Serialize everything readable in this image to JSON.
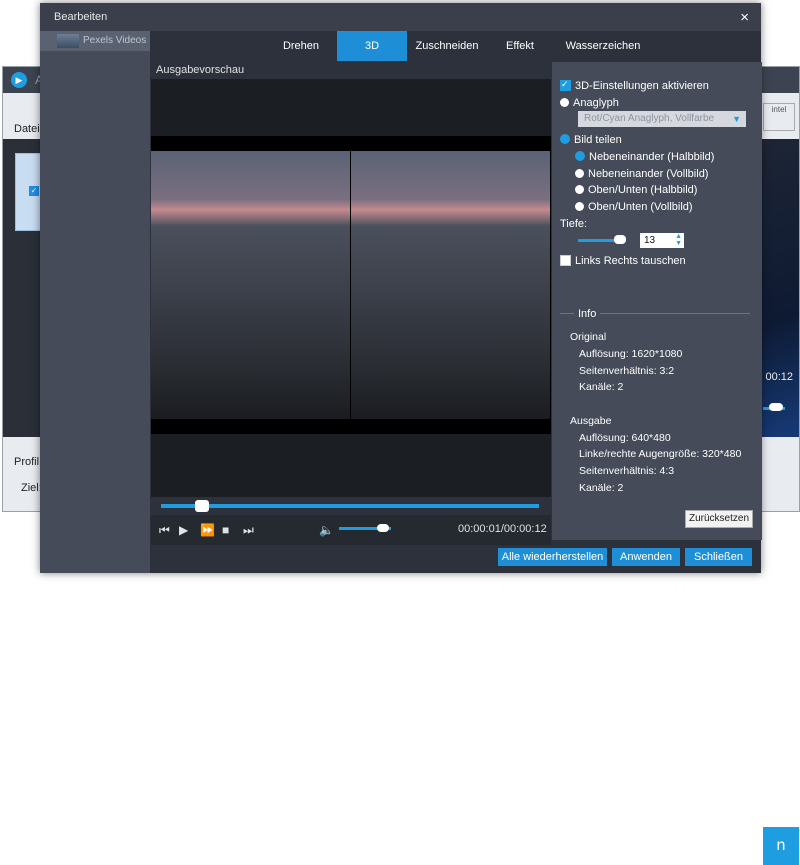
{
  "background_app": {
    "logo_letter": "A",
    "datei_label": "Datei l",
    "profil_label": "Profil:",
    "ziel_label": "Ziel:",
    "time_text": "00:12",
    "intel_label": "intel",
    "start_text": "n"
  },
  "dialog": {
    "title": "Bearbeiten",
    "close_icon": "×",
    "source_item": "Pexels Videos",
    "tabs": [
      "Drehen",
      "3D",
      "Zuschneiden",
      "Effekt",
      "Wasserzeichen"
    ],
    "active_tab": "3D",
    "preview_label": "Ausgabevorschau",
    "timecode": "00:00:01/00:00:12",
    "progress": 0.09,
    "volume": 0.8
  },
  "settings": {
    "enable_3d": "3D-Einstellungen aktivieren",
    "anaglyph": "Anaglyph",
    "anaglyph_option": "Rot/Cyan Anaglyph, Vollfarbe",
    "split": "Bild teilen",
    "split_options": [
      "Nebeneinander (Halbbild)",
      "Nebeneinander (Vollbild)",
      "Oben/Unten (Halbbild)",
      "Oben/Unten (Vollbild)"
    ],
    "depth_label": "Tiefe:",
    "depth_value": "13",
    "swap": "Links Rechts tauschen"
  },
  "info": {
    "title": "Info",
    "original_label": "Original",
    "original": [
      "Auflösung: 1620*1080",
      "Seitenverhältnis: 3:2",
      "Kanäle: 2"
    ],
    "output_label": "Ausgabe",
    "output": [
      "Auflösung: 640*480",
      "Linke/rechte Augengröße: 320*480",
      "Seitenverhältnis: 4:3",
      "Kanäle: 2"
    ],
    "reset": "Zurücksetzen"
  },
  "buttons": {
    "restore_all": "Alle wiederherstellen",
    "apply": "Anwenden",
    "close": "Schließen"
  },
  "colors": {
    "accent": "#1e8fd6",
    "panel": "#454b58",
    "dialog": "#2c313b"
  }
}
